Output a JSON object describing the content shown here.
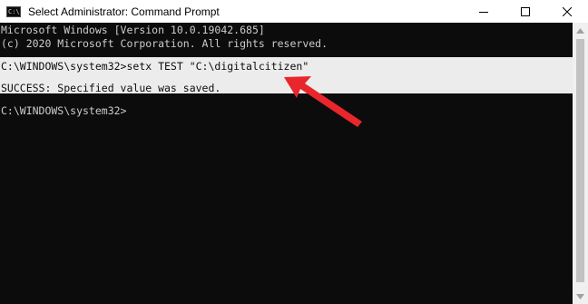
{
  "window": {
    "title": "Select Administrator: Command Prompt",
    "icon_label": "C:\\",
    "buttons": [
      "minimize-icon",
      "maximize-icon",
      "close-icon"
    ]
  },
  "console": {
    "lines": [
      "Microsoft Windows [Version 10.0.19042.685]",
      "(c) 2020 Microsoft Corporation. All rights reserved.",
      "",
      "C:\\WINDOWS\\system32>setx TEST \"C:\\digitalcitizen\"",
      "",
      "SUCCESS: Specified value was saved.",
      "",
      "C:\\WINDOWS\\system32>"
    ]
  },
  "colors": {
    "console_background": "#0c0c0c",
    "console_text": "#cccccc",
    "selection_background": "#ececec",
    "annotation_arrow": "#e8262c"
  },
  "annotation": {
    "type": "arrow",
    "icon": "red-arrow-icon"
  }
}
